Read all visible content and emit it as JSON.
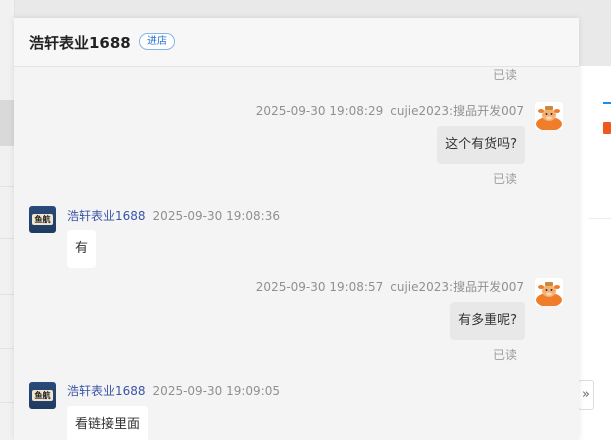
{
  "header": {
    "shop_name": "浩轩表业1688",
    "store_button": "进店"
  },
  "messages": [
    {
      "type": "read",
      "label": "已读"
    },
    {
      "type": "outgoing",
      "time": "2025-09-30 19:08:29",
      "sender": "cujie2023:搜品开发007",
      "text": "这个有货吗?",
      "read": "已读"
    },
    {
      "type": "incoming",
      "sender": "浩轩表业1688",
      "time": "2025-09-30 19:08:36",
      "text": "有"
    },
    {
      "type": "outgoing",
      "time": "2025-09-30 19:08:57",
      "sender": "cujie2023:搜品开发007",
      "text": "有多重呢?",
      "read": "已读"
    },
    {
      "type": "incoming",
      "sender": "浩轩表业1688",
      "time": "2025-09-30 19:09:05",
      "text": "看链接里面"
    }
  ],
  "shop_avatar_text": "鱼航",
  "expand_glyph": "»",
  "icons": {
    "my_avatar": "cartoon-cow-avatar-icon",
    "shop_avatar": "shop-logo-icon",
    "expand": "double-chevron-right-icon"
  },
  "colors": {
    "shop_name_link": "#3a55a8",
    "store_button_border": "#86b4e6",
    "incoming_bubble": "#ffffff",
    "outgoing_bubble": "#e8e8e8"
  }
}
